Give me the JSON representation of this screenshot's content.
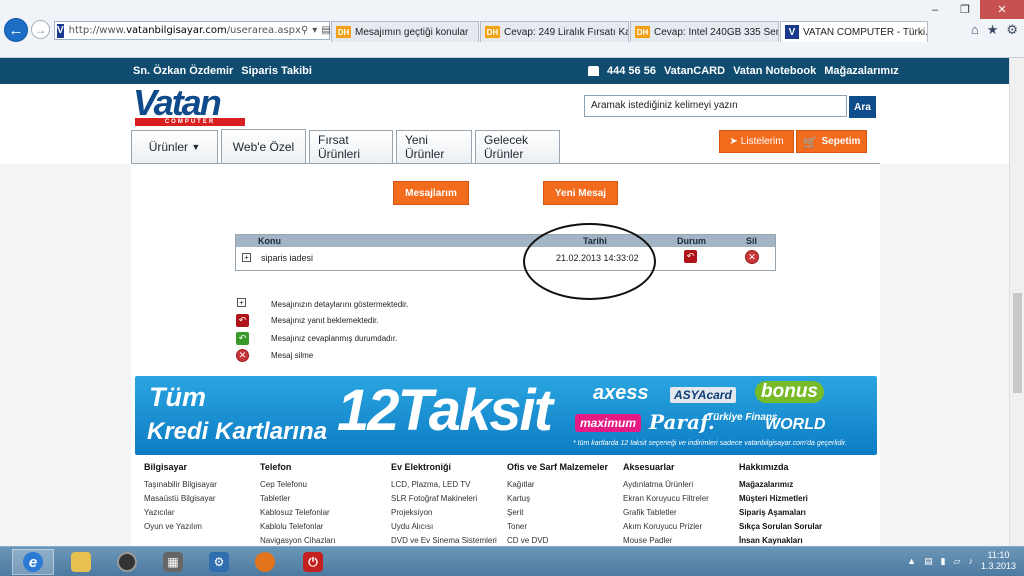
{
  "browser": {
    "url_prefix": "http://www.",
    "url_domain": "vatanbilgisayar.com",
    "url_path": "/userarea.aspx",
    "tabs": [
      {
        "label": "Mesajımın geçtiği konular",
        "icon": "DH"
      },
      {
        "label": "Cevap: 249 Liralık Fırsatı Kaçıra...",
        "icon": "DH"
      },
      {
        "label": "Cevap: Intel 240GB 335 Serisi S...",
        "icon": "DH"
      },
      {
        "label": "VATAN COMPUTER - Türki...",
        "icon": "V"
      }
    ],
    "tab_close": "×"
  },
  "topbar": {
    "user": "Sn. Özkan Özdemir",
    "order_tracking": "Siparis Takibi",
    "phone": "444 56 56",
    "links": [
      "VatanCARD",
      "Vatan Notebook",
      "Mağazalarımız"
    ]
  },
  "header": {
    "logo_word": "Vatan",
    "logo_sub": "COMPUTER",
    "search_placeholder": "Aramak istediğiniz kelimeyi yazın",
    "search_button": "Ara",
    "list_button": "Listelerim",
    "cart_button": "Sepetim"
  },
  "menu": {
    "tabs": [
      "Ürünler",
      "Web'e Özel",
      "Fırsat Ürünleri",
      "Yeni Ürünler",
      "Gelecek Ürünler"
    ]
  },
  "messages": {
    "my_messages_button": "Mesajlarım",
    "new_message_button": "Yeni Mesaj",
    "columns": {
      "subject": "Konu",
      "date": "Tarihi",
      "status": "Durum",
      "delete": "Sil"
    },
    "rows": [
      {
        "subject": "siparis iadesi",
        "date": "21.02.2013 14:33:02"
      }
    ],
    "legend": [
      "Mesajınızın detaylarını göstermektedir.",
      "Mesajınız yanıt beklemektedir.",
      "Mesajınız cevaplanmış durumdadır.",
      "Mesaj silme"
    ]
  },
  "banner": {
    "line1": "Tüm",
    "line2": "Kredi Kartlarına",
    "big": "12Taksit",
    "brands": [
      "axess",
      "ASYAcard",
      "bonus",
      "maximum",
      "Paraf.",
      "Türkiye Finans",
      "WORLD"
    ],
    "note": "* tüm kartlarda 12 taksit seçeneği ve indirimleri sadece vatanbilgisayar.com'da geçerlidir."
  },
  "footer": {
    "columns": [
      {
        "title": "Bilgisayar",
        "items": [
          "Taşınabilir Bilgisayar",
          "Masaüstü Bilgisayar",
          "Yazıcılar",
          "Oyun ve Yazılım"
        ]
      },
      {
        "title": "Telefon",
        "items": [
          "Cep Telefonu",
          "Tabletler",
          "Kablosuz Telefonlar",
          "Kablolu Telefonlar",
          "Navigasyon Cihazları"
        ]
      },
      {
        "title": "Ev Elektroniği",
        "items": [
          "LCD, Plazma, LED TV",
          "SLR Fotoğraf Makineleri",
          "Projeksiyon",
          "Uydu Alıcısı",
          "DVD ve Ev Sinema Sistemleri"
        ]
      },
      {
        "title": "Ofis ve Sarf Malzemeler",
        "items": [
          "Kağıtlar",
          "Kartuş",
          "Şerit",
          "Toner",
          "CD ve DVD"
        ]
      },
      {
        "title": "Aksesuarlar",
        "items": [
          "Aydınlatma Ürünleri",
          "Ekran Koruyucu Filtreler",
          "Grafik Tabletler",
          "Akım Koruyucu Prizler",
          "Mouse Padler"
        ]
      },
      {
        "title": "Hakkımızda",
        "items": [
          "Mağazalarımız",
          "Müşteri Hizmetleri",
          "Sipariş Aşamaları",
          "Sıkça Sorulan Sorular",
          "İnsan Kaynakları"
        ]
      }
    ]
  },
  "taskbar": {
    "time": "11:10",
    "date": "1.3.2013"
  }
}
